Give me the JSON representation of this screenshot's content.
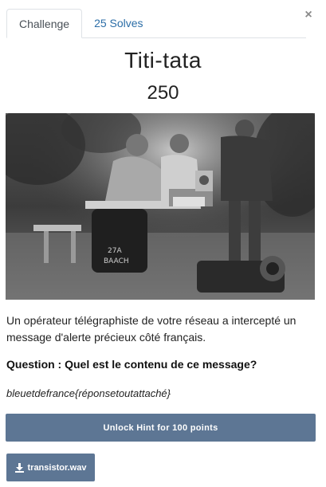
{
  "tabs": [
    {
      "label": "Challenge",
      "active": true
    },
    {
      "label": "25 Solves",
      "active": false
    }
  ],
  "close_icon": "×",
  "challenge": {
    "name": "Titi-tata",
    "points": "250",
    "image_alt": "Black and white photograph of telegraph operators at work outdoors, one seated at a table with equipment and others standing",
    "description": "Un opérateur télégraphiste de votre réseau a intercepté un message d'alerte précieux côté français.",
    "question": "Question : Quel est le contenu de ce message?",
    "flag_format": "bleuetdefrance{réponsetoutattaché}"
  },
  "hint": {
    "label": "Unlock Hint for 100 points"
  },
  "files": [
    {
      "name": "transistor.wav",
      "icon": "download-icon"
    }
  ],
  "colors": {
    "accent_button": "#5d7694",
    "tab_link": "#2c6ea7"
  }
}
